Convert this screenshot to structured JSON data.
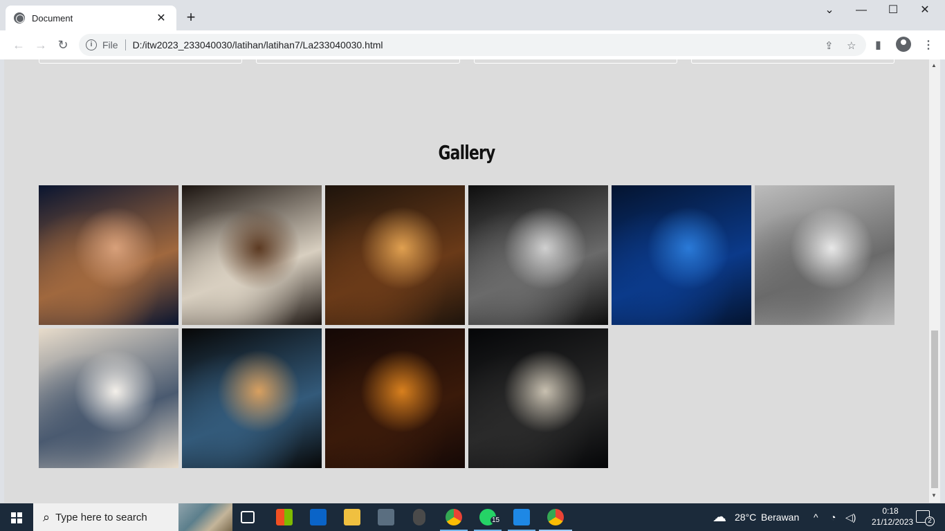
{
  "browser": {
    "tab_title": "Document",
    "tab_close": "✕",
    "new_tab": "+",
    "window_controls": {
      "list": "⌄",
      "minimize": "—",
      "maximize": "☐",
      "close": "✕"
    },
    "nav": {
      "back": "←",
      "forward": "→",
      "reload": "↻"
    },
    "omnibox": {
      "scheme_label": "File",
      "url": "D:/itw2023_233040030/latihan/latihan7/La233040030.html"
    },
    "icons": [
      "globe-icon",
      "info-icon",
      "share-icon",
      "star-icon",
      "side-panel-icon",
      "profile-icon",
      "menu-icon"
    ]
  },
  "page": {
    "gallery_title": "Gallery",
    "gallery_images": [
      {
        "name": "snake-photo",
        "colors": [
          "#0a1530",
          "#a0683e",
          "#d8a07a"
        ]
      },
      {
        "name": "iced-coffee-photo",
        "colors": [
          "#1b1410",
          "#d8cfc0",
          "#5c3a22"
        ]
      },
      {
        "name": "night-street-photo",
        "colors": [
          "#1e140c",
          "#6a3a18",
          "#e0a050"
        ]
      },
      {
        "name": "fashion-portrait-photo",
        "colors": [
          "#0e0e0e",
          "#6a6a6a",
          "#d0d0d0"
        ]
      },
      {
        "name": "blue-forest-photo",
        "colors": [
          "#041430",
          "#0b3a8a",
          "#2a7ad8"
        ]
      },
      {
        "name": "beach-man-photo",
        "colors": [
          "#bcbcbc",
          "#6a6a6a",
          "#e8e8e8"
        ]
      },
      {
        "name": "snowy-mountains-photo",
        "colors": [
          "#e8dccb",
          "#4a5a70",
          "#f4f0ea"
        ]
      },
      {
        "name": "window-city-photo",
        "colors": [
          "#070707",
          "#335a7a",
          "#d8a060"
        ]
      },
      {
        "name": "dark-bridge-photo",
        "colors": [
          "#140806",
          "#3a1a0a",
          "#d8801e"
        ]
      },
      {
        "name": "shadow-wall-photo",
        "colors": [
          "#050608",
          "#2a2a2a",
          "#c8c0b0"
        ]
      }
    ]
  },
  "taskbar": {
    "search_placeholder": "Type here to search",
    "weather_temp": "28°C",
    "weather_text": "Berawan",
    "time": "0:18",
    "date": "21/12/2023",
    "whatsapp_badge": "15",
    "notification_count": "2",
    "tray_chevron": "^",
    "apps": [
      "task-view-icon",
      "store-icon",
      "mail-icon",
      "file-explorer-icon",
      "camera-icon",
      "mouse-icon",
      "chrome-icon",
      "whatsapp-icon",
      "vscode-icon",
      "chrome-active-icon"
    ]
  }
}
